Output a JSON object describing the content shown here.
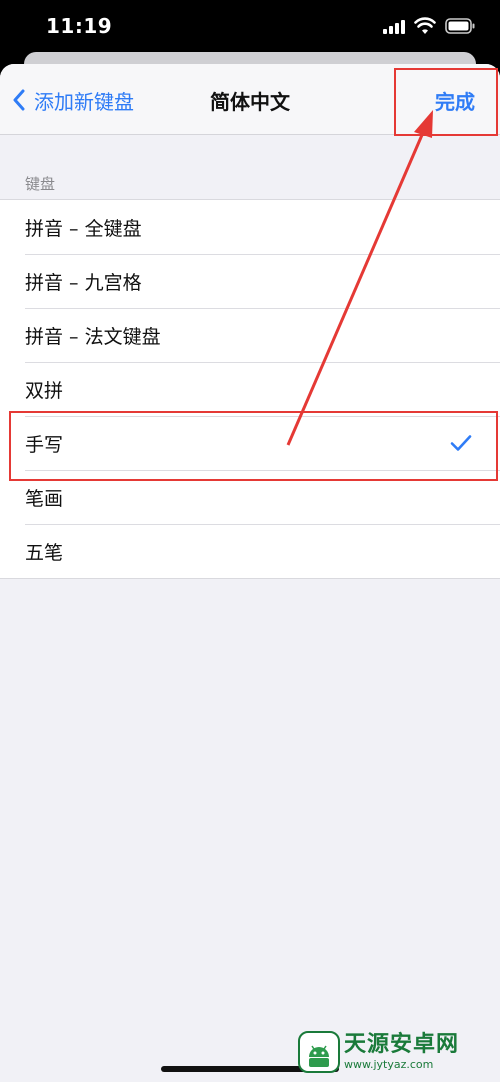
{
  "status_bar": {
    "time": "11:19"
  },
  "nav": {
    "back_label": "添加新键盘",
    "title": "简体中文",
    "done_label": "完成"
  },
  "section": {
    "header": "键盘"
  },
  "keyboards": [
    {
      "label": "拼音 – 全键盘",
      "selected": false
    },
    {
      "label": "拼音 – 九宫格",
      "selected": false
    },
    {
      "label": "拼音 – 法文键盘",
      "selected": false
    },
    {
      "label": "双拼",
      "selected": false
    },
    {
      "label": "手写",
      "selected": true
    },
    {
      "label": "笔画",
      "selected": false
    },
    {
      "label": "五笔",
      "selected": false
    }
  ],
  "watermark": {
    "title": "天源安卓网",
    "url": "www.jytyaz.com"
  },
  "colors": {
    "accent": "#2f7cf6",
    "annotation": "#e53935",
    "watermark": "#1a7a3a"
  }
}
